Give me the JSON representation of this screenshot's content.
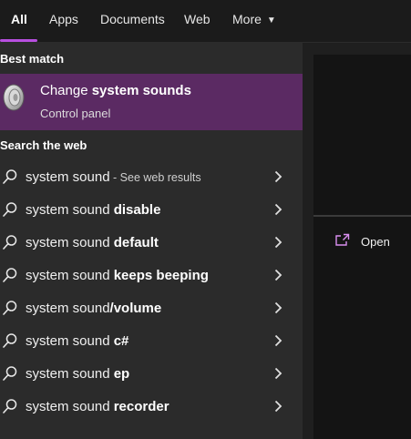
{
  "tabs": [
    {
      "label": "All"
    },
    {
      "label": "Apps"
    },
    {
      "label": "Documents"
    },
    {
      "label": "Web"
    },
    {
      "label": "More"
    }
  ],
  "best_match": {
    "header": "Best match",
    "title_prefix": "Change ",
    "title_bold": "system sounds",
    "subtitle": "Control panel"
  },
  "web": {
    "header": "Search the web",
    "results": [
      {
        "prefix": "system sound",
        "bold": "",
        "suffix": " - See web results"
      },
      {
        "prefix": "system sound ",
        "bold": "disable",
        "suffix": ""
      },
      {
        "prefix": "system sound ",
        "bold": "default",
        "suffix": ""
      },
      {
        "prefix": "system sound ",
        "bold": "keeps beeping",
        "suffix": ""
      },
      {
        "prefix": "system sound",
        "bold": "/volume",
        "suffix": ""
      },
      {
        "prefix": "system sound ",
        "bold": "c#",
        "suffix": ""
      },
      {
        "prefix": "system sound ",
        "bold": "ep",
        "suffix": ""
      },
      {
        "prefix": "system sound ",
        "bold": "recorder",
        "suffix": ""
      }
    ]
  },
  "preview": {
    "open_label": "Open"
  },
  "colors": {
    "accent": "#b84fe0",
    "best_match_bg": "#5b2a63",
    "pane_bg": "#2b2b2b"
  }
}
